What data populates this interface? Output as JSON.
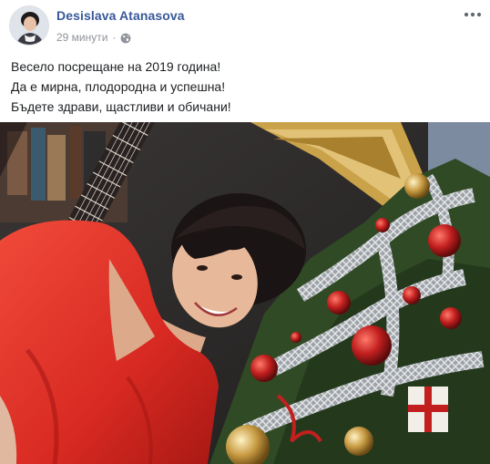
{
  "post": {
    "author": "Desislava Atanasova",
    "timestamp": "29 минути",
    "separator": "·",
    "privacy_icon": "globe-icon",
    "more_icon": "more-options-icon",
    "lines": [
      "Весело посрещане на 2019 година!",
      "Да е мирна, плодородна и успешна!",
      "Бъдете здрави, щастливи и обичани!"
    ]
  },
  "colors": {
    "author_link": "#385898",
    "meta_text": "#90949c",
    "body_text": "#1c1e21",
    "dress_red": "#e8322a",
    "tree_green": "#2f4a24",
    "tinsel_silver": "#c9ccd1",
    "frame_gold": "#c9a24a"
  }
}
